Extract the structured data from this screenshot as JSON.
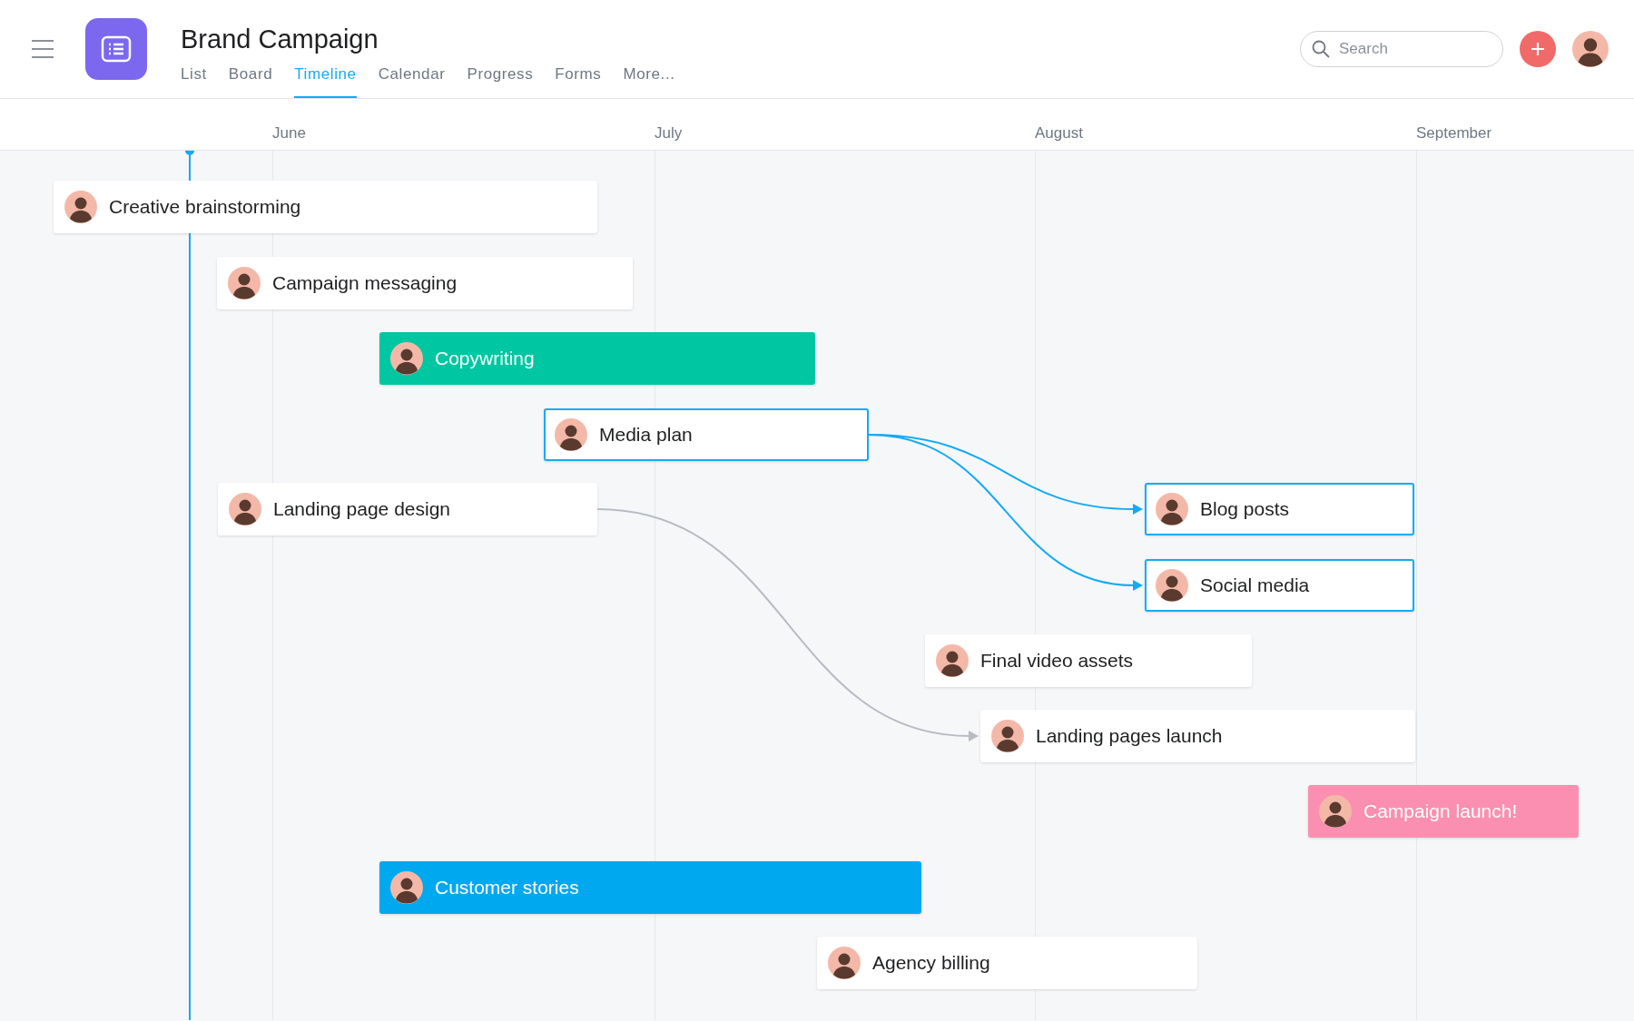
{
  "project": {
    "title": "Brand Campaign"
  },
  "tabs": [
    {
      "label": "List",
      "selected": false
    },
    {
      "label": "Board",
      "selected": false
    },
    {
      "label": "Timeline",
      "selected": true
    },
    {
      "label": "Calendar",
      "selected": false
    },
    {
      "label": "Progress",
      "selected": false
    },
    {
      "label": "Forms",
      "selected": false
    },
    {
      "label": "More...",
      "selected": false
    }
  ],
  "search": {
    "placeholder": "Search"
  },
  "months": [
    "June",
    "July",
    "August",
    "September"
  ],
  "tasks": [
    {
      "name": "Creative brainstorming",
      "color": "#ffffff",
      "highlighted": false
    },
    {
      "name": "Campaign messaging",
      "color": "#ffffff",
      "highlighted": false
    },
    {
      "name": "Copywriting",
      "color": "#00c7a2",
      "highlighted": false
    },
    {
      "name": "Media plan",
      "color": "#ffffff",
      "highlighted": true
    },
    {
      "name": "Landing page design",
      "color": "#ffffff",
      "highlighted": false
    },
    {
      "name": "Blog posts",
      "color": "#ffffff",
      "highlighted": true
    },
    {
      "name": "Social media",
      "color": "#ffffff",
      "highlighted": true
    },
    {
      "name": "Final video assets",
      "color": "#ffffff",
      "highlighted": false
    },
    {
      "name": "Landing pages launch",
      "color": "#ffffff",
      "highlighted": false
    },
    {
      "name": "Campaign launch!",
      "color": "#fb8fb1",
      "highlighted": false
    },
    {
      "name": "Customer stories",
      "color": "#00a9ef",
      "highlighted": false
    },
    {
      "name": "Agency billing",
      "color": "#ffffff",
      "highlighted": false
    }
  ]
}
